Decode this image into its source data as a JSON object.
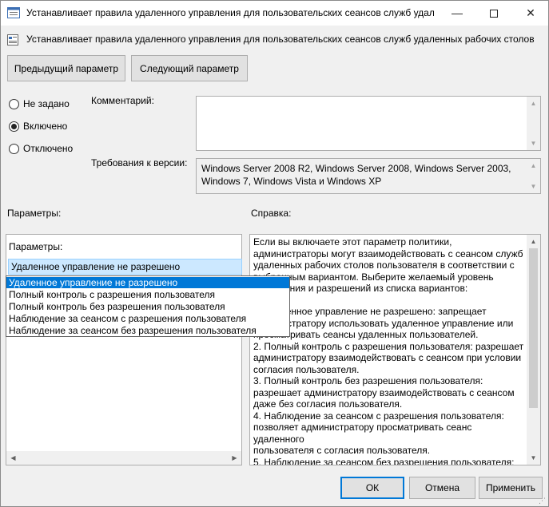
{
  "window": {
    "title": "Устанавливает правила удаленного управления для пользовательских сеансов служб удал...",
    "minimize_glyph": "—",
    "close_glyph": "✕"
  },
  "header": {
    "text": "Устанавливает правила удаленного управления для пользовательских сеансов служб удаленных рабочих столов"
  },
  "nav": {
    "prev_label": "Предыдущий параметр",
    "next_label": "Следующий параметр"
  },
  "state": {
    "options": [
      {
        "label": "Не задано",
        "checked": false
      },
      {
        "label": "Включено",
        "checked": true
      },
      {
        "label": "Отключено",
        "checked": false
      }
    ]
  },
  "comment": {
    "label": "Комментарий:",
    "value": ""
  },
  "version": {
    "label": "Требования к версии:",
    "value": "Windows Server 2008 R2, Windows Server 2008, Windows Server 2003, Windows 7, Windows Vista и Windows XP"
  },
  "sections": {
    "params_label": "Параметры:",
    "help_label": "Справка:"
  },
  "params": {
    "inner_label": "Параметры:",
    "selected_value": "Удаленное управление не разрешено",
    "options": [
      "Удаленное управление не разрешено",
      "Полный контроль с разрешения пользователя",
      "Полный контроль без разрешения пользователя",
      "Наблюдение за сеансом с разрешения пользователя",
      "Наблюдение за сеансом без разрешения пользователя"
    ]
  },
  "help": {
    "text": "Если вы включаете этот параметр политики,\nадминистраторы могут взаимодействовать с сеансом служб\nудаленных рабочих столов пользователя в соответствии с\nвыбранным вариантом. Выберите желаемый уровень\nуправления и разрешений из списка вариантов:\n\n1. Удаленное управление не разрешено: запрещает\nадминистратору использовать удаленное управление или\nпросматривать сеансы удаленных пользователей.\n2. Полный контроль с разрешения пользователя: разрешает\nадминистратору взаимодействовать с сеансом при условии\nсогласия пользователя.\n3. Полный контроль без разрешения пользователя:\nразрешает администратору взаимодействовать с сеансом\nдаже без согласия пользователя.\n4. Наблюдение за сеансом с разрешения пользователя:\nпозволяет администратору просматривать сеанс удаленного\nпользователя с согласия пользователя.\n5. Наблюдение за сеансом без разрешения пользователя:"
  },
  "footer": {
    "ok_label": "ОК",
    "cancel_label": "Отмена",
    "apply_label": "Применить"
  },
  "colors": {
    "accent": "#0078d7",
    "selection": "#cce8ff"
  }
}
